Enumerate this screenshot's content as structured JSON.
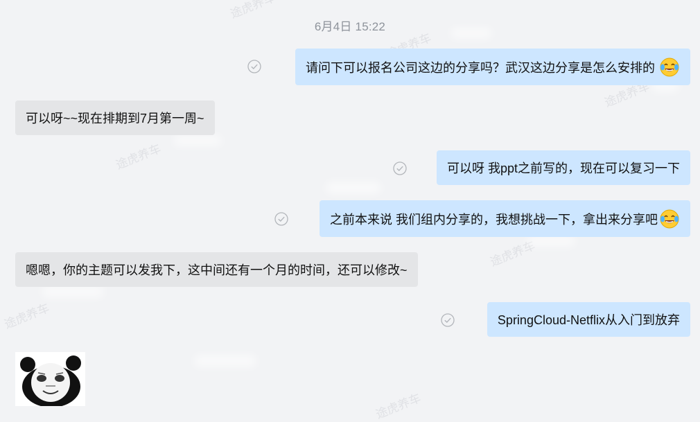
{
  "timestamp": "6月4日 15:22",
  "messages": [
    {
      "side": "right",
      "text": "请问下可以报名公司这边的分享吗？武汉这边分享是怎么安排的",
      "emoji": "laughing-tears-icon",
      "status": "read-check-icon"
    },
    {
      "side": "left",
      "text": "可以呀~~现在排期到7月第一周~"
    },
    {
      "side": "right",
      "text": "可以呀  我ppt之前写的，现在可以复习一下",
      "status": "read-check-icon"
    },
    {
      "side": "right",
      "text": "之前本来说 我们组内分享的，我想挑战一下，拿出来分享吧",
      "emoji": "laughing-tears-icon",
      "status": "read-check-icon"
    },
    {
      "side": "left",
      "text": "嗯嗯，你的主题可以发我下，这中间还有一个月的时间，还可以修改~"
    },
    {
      "side": "right",
      "text": "SpringCloud-Netflix从入门到放弃",
      "status": "read-check-icon"
    }
  ],
  "sticker": {
    "name": "panda-meme-sticker"
  },
  "watermark": "途虎养车",
  "colors": {
    "background": "#f2f3f5",
    "outgoing_bubble": "#cde6ff",
    "incoming_bubble": "#e4e5e7",
    "timestamp": "#8e939b"
  }
}
